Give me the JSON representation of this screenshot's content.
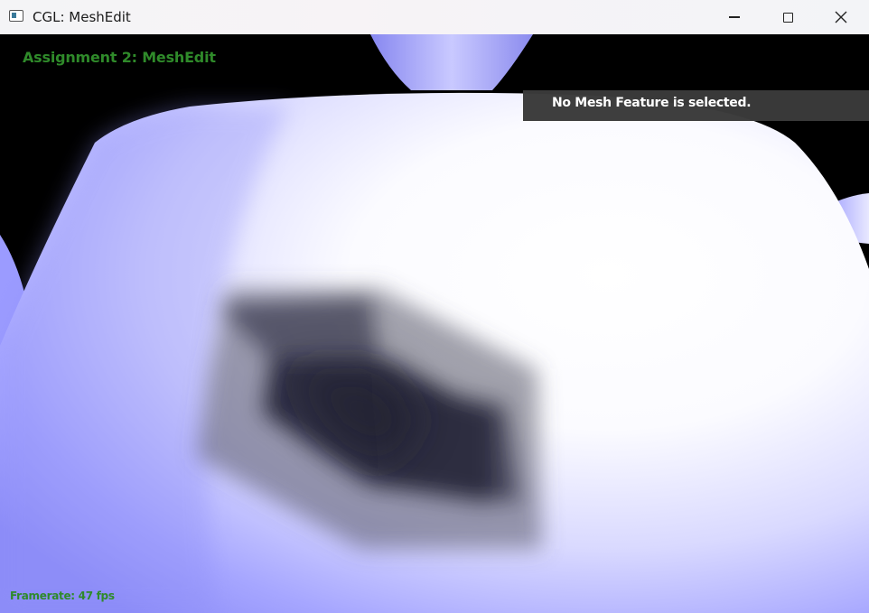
{
  "window": {
    "title": "CGL: MeshEdit",
    "icon": "app-window-icon",
    "controls": {
      "minimize": "minimize-icon",
      "maximize": "maximize-icon",
      "close": "close-icon"
    }
  },
  "hud": {
    "title": "Assignment 2: MeshEdit",
    "status": "No Mesh Feature is selected.",
    "framerate": "Framerate: 47 fps"
  },
  "colors": {
    "hud_green": "#2f8a2a",
    "mesh_blue": "#8c8cff",
    "mesh_white": "#ffffff",
    "background": "#000000",
    "panel": "#3a3a3a"
  }
}
